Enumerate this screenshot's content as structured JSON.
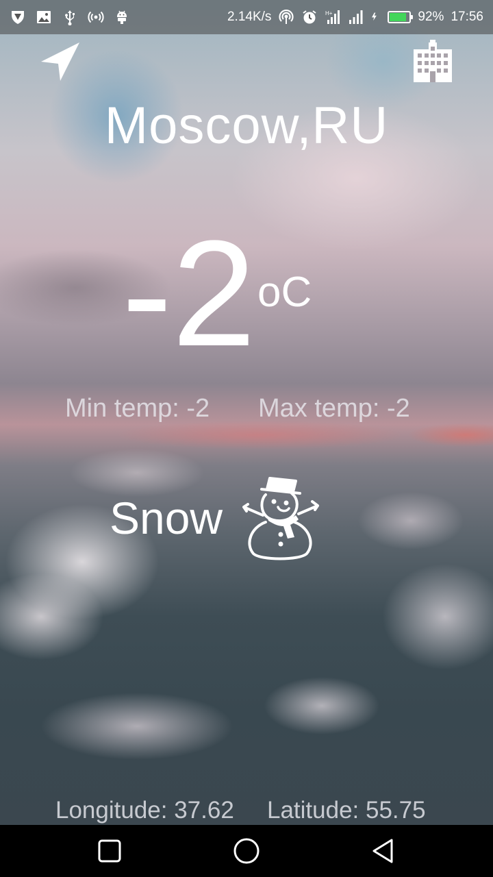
{
  "status_bar": {
    "left_icons": [
      "shield-app-icon",
      "gallery-icon",
      "usb-icon",
      "hotspot-icon",
      "android-debug-icon"
    ],
    "net_speed": "2.14K/s",
    "battery_percent": "92%",
    "battery_level": 0.92,
    "time": "17:56",
    "right_icons": [
      "wifi-hotspot-icon",
      "alarm-icon",
      "signal-hplus-icon",
      "signal-icon",
      "charging-icon",
      "battery-icon"
    ]
  },
  "header": {
    "location_button_icon": "location-arrow-icon",
    "city_button_icon": "city-buildings-icon"
  },
  "weather": {
    "city": "Moscow,RU",
    "temperature": "-2",
    "unit": "oC",
    "min_temp": "Min temp: -2",
    "max_temp": "Max temp: -2",
    "description": "Snow",
    "condition_icon": "snowman-icon"
  },
  "footer": {
    "longitude": "Longitude: 37.62",
    "latitude": "Latitude: 55.75"
  },
  "nav_bar": {
    "buttons": [
      "recent-apps-square-icon",
      "home-circle-icon",
      "back-triangle-icon"
    ]
  },
  "colors": {
    "battery_fill": "#42d65a",
    "text": "#ffffff"
  }
}
